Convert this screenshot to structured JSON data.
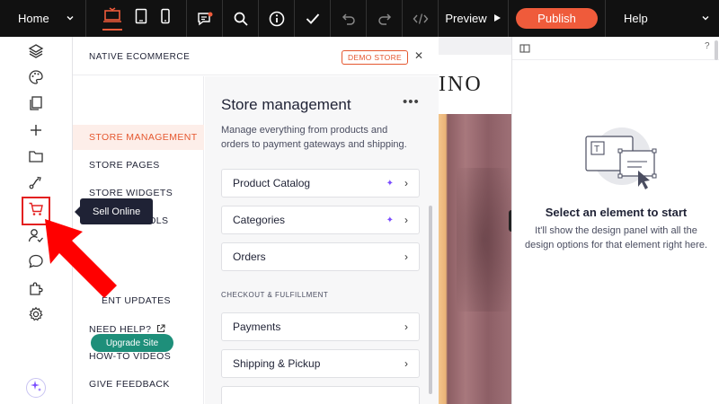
{
  "topbar": {
    "page_select": "Home",
    "preview_label": "Preview",
    "publish_label": "Publish",
    "help_label": "Help"
  },
  "tooltip": {
    "text": "Sell Online"
  },
  "panel": {
    "title": "NATIVE ECOMMERCE",
    "badge": "DEMO STORE",
    "nav": [
      {
        "label": "STORE MANAGEMENT"
      },
      {
        "label": "STORE PAGES"
      },
      {
        "label": "STORE WIDGETS"
      },
      {
        "label": "GOOGLE TOOLS"
      },
      {
        "label": "ENT UPDATES"
      },
      {
        "label": "NEED HELP?"
      },
      {
        "label": "HOW-TO VIDEOS"
      },
      {
        "label": "GIVE FEEDBACK"
      }
    ],
    "upgrade_label": "Upgrade Site",
    "content": {
      "title": "Store management",
      "description": "Manage everything from products and orders to payment gateways and shipping.",
      "cards": [
        {
          "label": "Product Catalog"
        },
        {
          "label": "Categories"
        },
        {
          "label": "Orders"
        }
      ],
      "section_label": "CHECKOUT & FULFILLMENT",
      "checkout_cards": [
        {
          "label": "Payments"
        },
        {
          "label": "Shipping & Pickup"
        }
      ]
    }
  },
  "canvas": {
    "heading_fragment": "INO"
  },
  "inspector": {
    "help": "?",
    "title": "Select an element to start",
    "description": "It'll show the design panel with all the design options for that element right here."
  },
  "colors": {
    "accent": "#ef5b3b",
    "upgrade": "#1e8f7a",
    "sparkle": "#7b4dff",
    "highlight_red": "#e32020"
  }
}
